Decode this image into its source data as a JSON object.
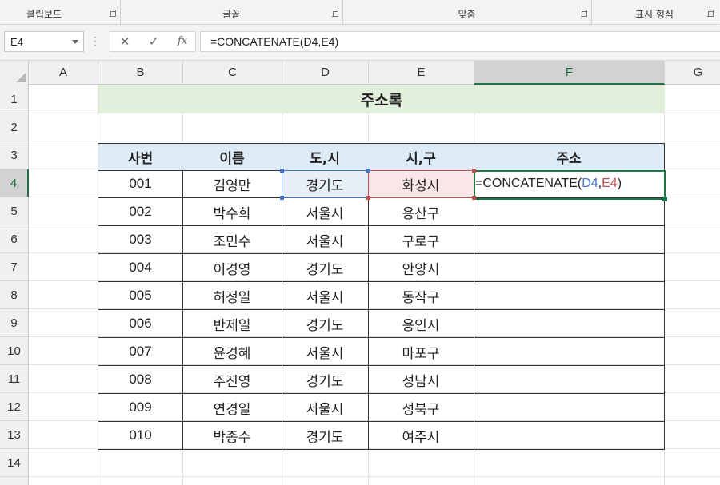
{
  "ribbon": {
    "groups": [
      {
        "label": "클립보드"
      },
      {
        "label": "글꼴"
      },
      {
        "label": "맞춤"
      },
      {
        "label": "표시 형식"
      }
    ]
  },
  "formula_bar": {
    "name_box": "E4",
    "formula": "=CONCATENATE(D4,E4)",
    "cancel_icon": "x-icon",
    "enter_icon": "check-icon",
    "function_label": "fx"
  },
  "columns": [
    "A",
    "B",
    "C",
    "D",
    "E",
    "F",
    "G"
  ],
  "rows": [
    "1",
    "2",
    "3",
    "4",
    "5",
    "6",
    "7",
    "8",
    "9",
    "10",
    "11",
    "12",
    "13",
    "14"
  ],
  "active_column": "F",
  "active_row": "4",
  "sheet": {
    "title": "주소록",
    "headers": [
      "사번",
      "이름",
      "도,시",
      "시,구",
      "주소"
    ],
    "records": [
      [
        "001",
        "김영만",
        "경기도",
        "화성시",
        ""
      ],
      [
        "002",
        "박수희",
        "서울시",
        "용산구",
        ""
      ],
      [
        "003",
        "조민수",
        "서울시",
        "구로구",
        ""
      ],
      [
        "004",
        "이경영",
        "경기도",
        "안양시",
        ""
      ],
      [
        "005",
        "허정일",
        "서울시",
        "동작구",
        ""
      ],
      [
        "006",
        "반제일",
        "경기도",
        "용인시",
        ""
      ],
      [
        "007",
        "윤경혜",
        "서울시",
        "마포구",
        ""
      ],
      [
        "008",
        "주진영",
        "경기도",
        "성남시",
        ""
      ],
      [
        "009",
        "연경일",
        "서울시",
        "성북구",
        ""
      ],
      [
        "010",
        "박종수",
        "경기도",
        "여주시",
        ""
      ]
    ],
    "editing_cell": {
      "prefix": "=CONCATENATE(",
      "ref1": "D4",
      "sep": ",",
      "ref2": "E4",
      "suffix": ")"
    }
  },
  "colors": {
    "accent_green": "#217346",
    "ref_blue": "#4472c4",
    "ref_red": "#c0504d",
    "header_fill": "#ddebf7",
    "title_fill": "#e2efda"
  }
}
